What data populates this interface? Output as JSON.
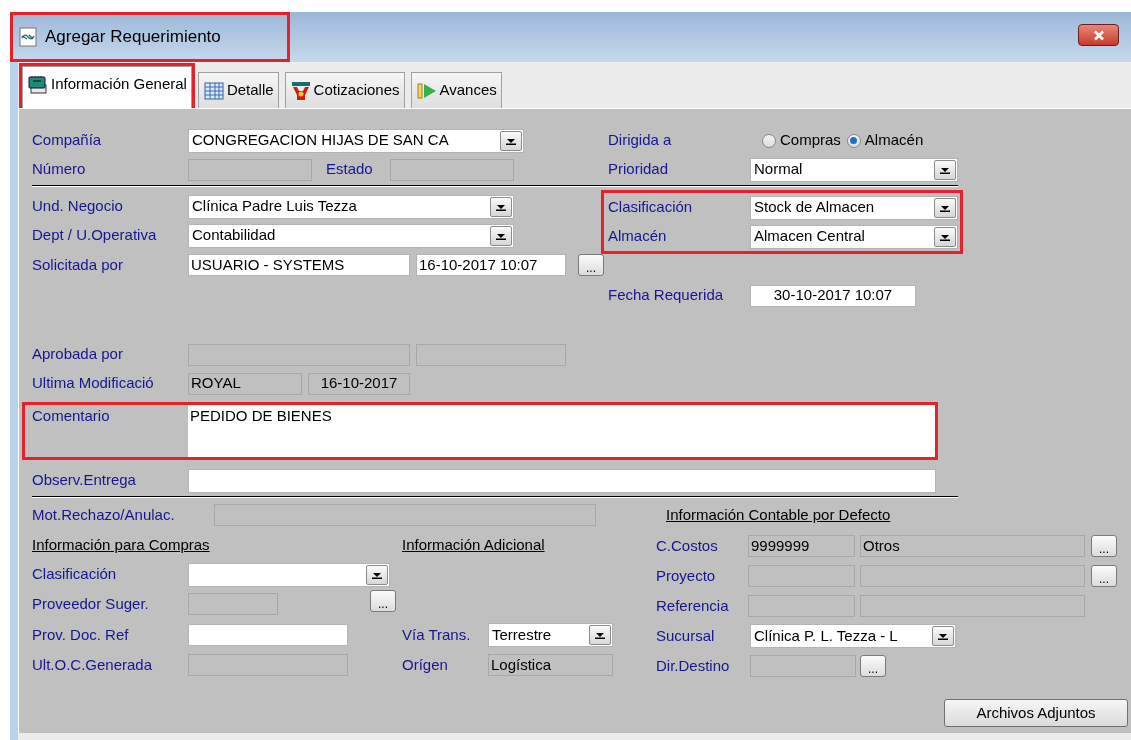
{
  "window": {
    "title": "Agregar Requerimiento",
    "highlighted": true
  },
  "tabs": [
    {
      "label": "Información General",
      "selected": true,
      "highlighted": true
    },
    {
      "label": "Detalle",
      "selected": false,
      "highlighted": false
    },
    {
      "label": "Cotizaciones",
      "selected": false,
      "highlighted": false
    },
    {
      "label": "Avances",
      "selected": false,
      "highlighted": false
    }
  ],
  "general": {
    "compania": {
      "label": "Compañía",
      "value": "CONGREGACION HIJAS DE SAN CA"
    },
    "numero": {
      "label": "Número",
      "disabled": true
    },
    "estado": {
      "label": "Estado",
      "disabled": true
    },
    "dirigida_a": {
      "label": "Dirigida a",
      "options": [
        {
          "label": "Compras",
          "selected": false
        },
        {
          "label": "Almacén",
          "selected": true
        }
      ]
    },
    "prioridad": {
      "label": "Prioridad",
      "value": "Normal"
    },
    "und_negocio": {
      "label": "Und. Negocio",
      "value": "Clínica Padre Luis Tezza"
    },
    "dept": {
      "label": "Dept / U.Operativa",
      "value": "Contabilidad"
    },
    "solicitada_por": {
      "label": "Solicitada por",
      "value": "USUARIO - SYSTEMS",
      "date": "16-10-2017  10:07",
      "button": "..."
    },
    "stock_group": {
      "highlighted": true
    },
    "clasificacion": {
      "label": "Clasificación",
      "value": "Stock de Almacen"
    },
    "almacen": {
      "label": "Almacén",
      "value": "Almacen Central"
    },
    "fecha_requerida": {
      "label": "Fecha Requerida",
      "value": "30-10-2017 10:07"
    },
    "aprobada_por": {
      "label": "Aprobada por",
      "disabled": true
    },
    "ultima_modificacion": {
      "label": "Ultima Modificació",
      "user": "ROYAL",
      "date": "16-10-2017"
    },
    "comentario": {
      "label": "Comentario",
      "value": "PEDIDO DE BIENES",
      "highlighted": true
    },
    "observ_entrega": {
      "label": "Observ.Entrega",
      "disabled": false
    },
    "mot_rechazo": {
      "label": "Mot.Rechazo/Anulac.",
      "disabled": true
    }
  },
  "compras": {
    "heading": "Información para Compras",
    "clasificacion": {
      "label": "Clasificación"
    },
    "proveedor": {
      "label": "Proveedor Suger.",
      "disabled": true,
      "button": "..."
    },
    "prov_doc_ref": {
      "label": "Prov. Doc. Ref",
      "disabled": false
    },
    "ult_oc": {
      "label": "Ult.O.C.Generada",
      "disabled": true
    }
  },
  "adicional": {
    "heading": "Información Adicional",
    "via_trans": {
      "label": "Vía Trans.",
      "value": "Terrestre"
    },
    "origen": {
      "label": "Orígen",
      "value": "Logística"
    }
  },
  "contable": {
    "heading": "Información Contable por Defecto",
    "c_costos": {
      "label": "C.Costos",
      "code": "9999999",
      "name": "Otros",
      "button": "..."
    },
    "proyecto": {
      "label": "Proyecto",
      "button": "..."
    },
    "referencia": {
      "label": "Referencia"
    },
    "sucursal": {
      "label": "Sucursal",
      "value": "Clínica P. L. Tezza - L"
    },
    "dir_destino": {
      "label": "Dir.Destino",
      "button": "..."
    }
  },
  "footer_button": "Archivos Adjuntos"
}
